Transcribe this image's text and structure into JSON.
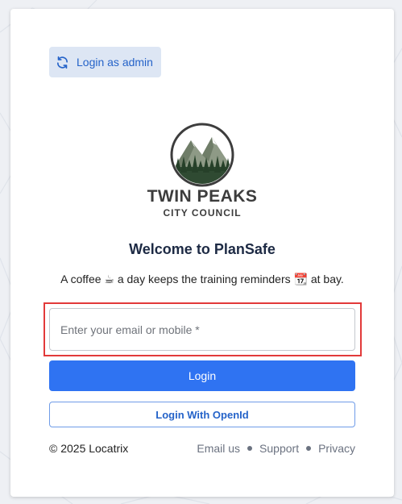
{
  "admin_button": {
    "label": "Login as admin",
    "icon": "refresh-icon"
  },
  "brand": {
    "line1": "TWIN PEAKS",
    "line2": "CITY COUNCIL"
  },
  "welcome": {
    "title": "Welcome to PlanSafe"
  },
  "tagline": {
    "text": "A coffee ☕ a day keeps the training reminders 📆 at bay."
  },
  "email": {
    "placeholder": "Enter your email or mobile *",
    "value": ""
  },
  "buttons": {
    "login": "Login",
    "openid": "Login With OpenId"
  },
  "footer": {
    "copyright": "© 2025 Locatrix",
    "links": [
      "Email us",
      "Support",
      "Privacy"
    ]
  },
  "colors": {
    "primary": "#2f73f2",
    "accent_text": "#2563c9",
    "highlight": "#e23a3a",
    "background": "#eef0f4"
  }
}
